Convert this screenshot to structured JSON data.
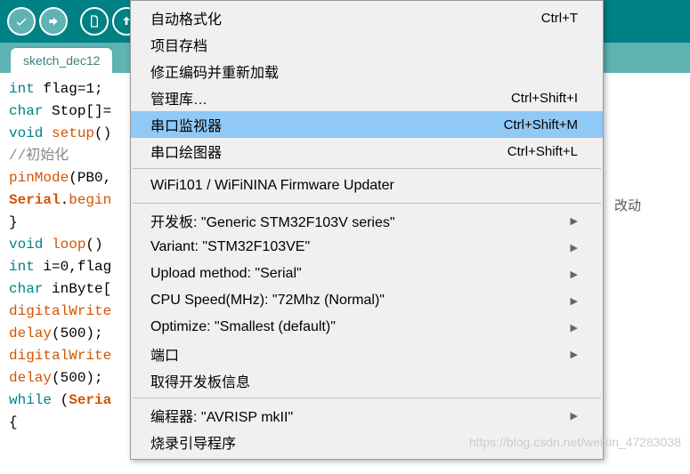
{
  "toolbar": {
    "verify": "✓",
    "upload": "→",
    "new": "▦",
    "open": "↑"
  },
  "tab": {
    "label": "sketch_dec12"
  },
  "code": {
    "l1_a": "int",
    "l1_b": " flag=1;",
    "l2_a": "char",
    "l2_b": " Stop[]=",
    "l3_a": "void",
    "l3_b": " ",
    "l3_c": "setup",
    "l3_d": "()",
    "l4": "//初始化",
    "l5_a": "pinMode",
    "l5_b": "(PB0,",
    "l6_a": "Serial",
    "l6_b": ".",
    "l6_c": "begin",
    "l7": "}",
    "l8_a": "void",
    "l8_b": " ",
    "l8_c": "loop",
    "l8_d": "()",
    "l9_a": "int",
    "l9_b": " i=0,flag",
    "l10_a": "char",
    "l10_b": " inByte[",
    "l11_a": "digitalWrite",
    "l12_a": "delay",
    "l12_b": "(500);",
    "l13_a": "digitalWrite",
    "l14_a": "delay",
    "l14_b": "(500);",
    "l15_a": "while",
    "l15_b": " (",
    "l15_c": "Seria",
    "l16": "{"
  },
  "menu": {
    "auto_format": {
      "label": "自动格式化",
      "shortcut": "Ctrl+T"
    },
    "archive": {
      "label": "项目存档"
    },
    "fix_encoding": {
      "label": "修正编码并重新加载"
    },
    "manage_libs": {
      "label": "管理库…",
      "shortcut": "Ctrl+Shift+I"
    },
    "serial_monitor": {
      "label": "串口监视器",
      "shortcut": "Ctrl+Shift+M"
    },
    "serial_plotter": {
      "label": "串口绘图器",
      "shortcut": "Ctrl+Shift+L"
    },
    "wifi_updater": {
      "label": "WiFi101 / WiFiNINA Firmware Updater"
    },
    "board": {
      "label": "开发板: \"Generic STM32F103V series\""
    },
    "variant": {
      "label": "Variant: \"STM32F103VE\""
    },
    "upload_method": {
      "label": "Upload method: \"Serial\""
    },
    "cpu_speed": {
      "label": "CPU Speed(MHz): \"72Mhz (Normal)\""
    },
    "optimize": {
      "label": "Optimize: \"Smallest (default)\""
    },
    "port": {
      "label": "端口"
    },
    "board_info": {
      "label": "取得开发板信息"
    },
    "programmer": {
      "label": "编程器: \"AVRISP mkII\""
    },
    "burn_bootloader": {
      "label": "烧录引导程序"
    }
  },
  "bg_text": "改动",
  "watermark": "https://blog.csdn.net/weixin_47283038"
}
